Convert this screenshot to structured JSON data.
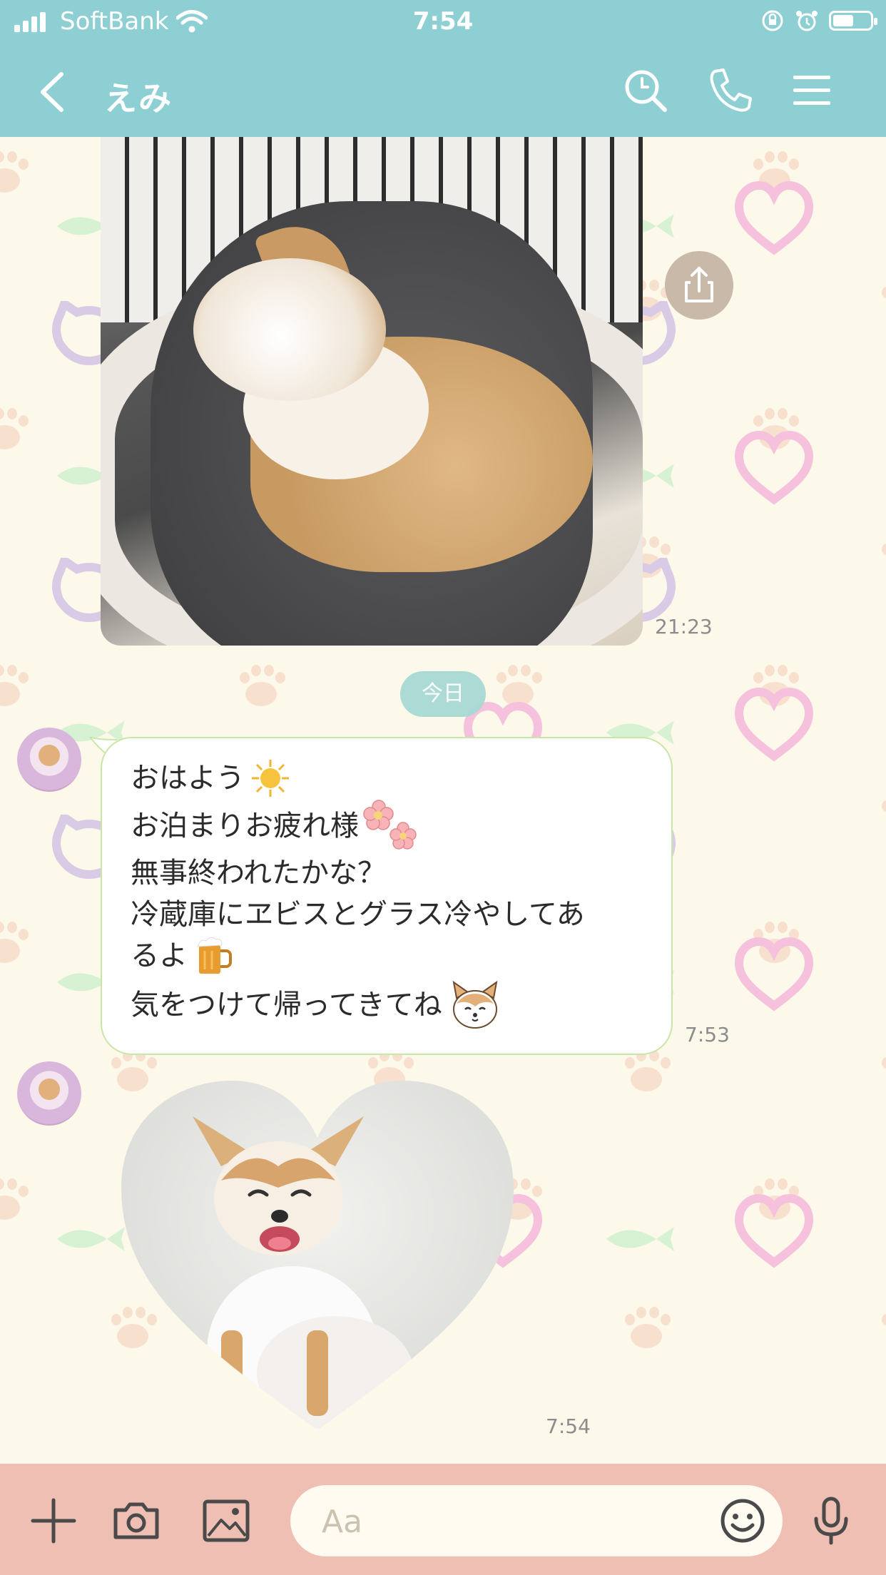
{
  "status_bar": {
    "carrier": "SoftBank",
    "time": "7:54",
    "battery_level": 0.55
  },
  "header": {
    "title": "えみ",
    "icons": [
      "chevron-left-icon",
      "search-icon",
      "phone-icon",
      "menu-icon"
    ]
  },
  "messages": [
    {
      "type": "image",
      "direction": "sent",
      "description_icon": "dog-photo",
      "timestamp": "21:23"
    },
    {
      "type": "date_separator",
      "label": "今日"
    },
    {
      "type": "text",
      "direction": "received",
      "lines": [
        "おはよう",
        "お泊まりお疲れ様",
        "無事終われたかな？",
        "冷蔵庫にヱビスとグラス冷やしてあ",
        "るよ",
        "気をつけて帰ってきてね"
      ],
      "emoji_names": [
        "sun-icon",
        "flower-icon",
        "beer-icon",
        "dog-sticker-icon"
      ],
      "timestamp": "7:53"
    },
    {
      "type": "heart_image",
      "direction": "received",
      "timestamp": "7:54"
    }
  ],
  "input": {
    "placeholder": "Aa"
  },
  "colors": {
    "header_bg": "#8ecfd3",
    "bottom_bar_bg": "#efbfb3",
    "bubble_border": "#c9e6a8",
    "wallpaper_bg": "#fdf9ea"
  }
}
